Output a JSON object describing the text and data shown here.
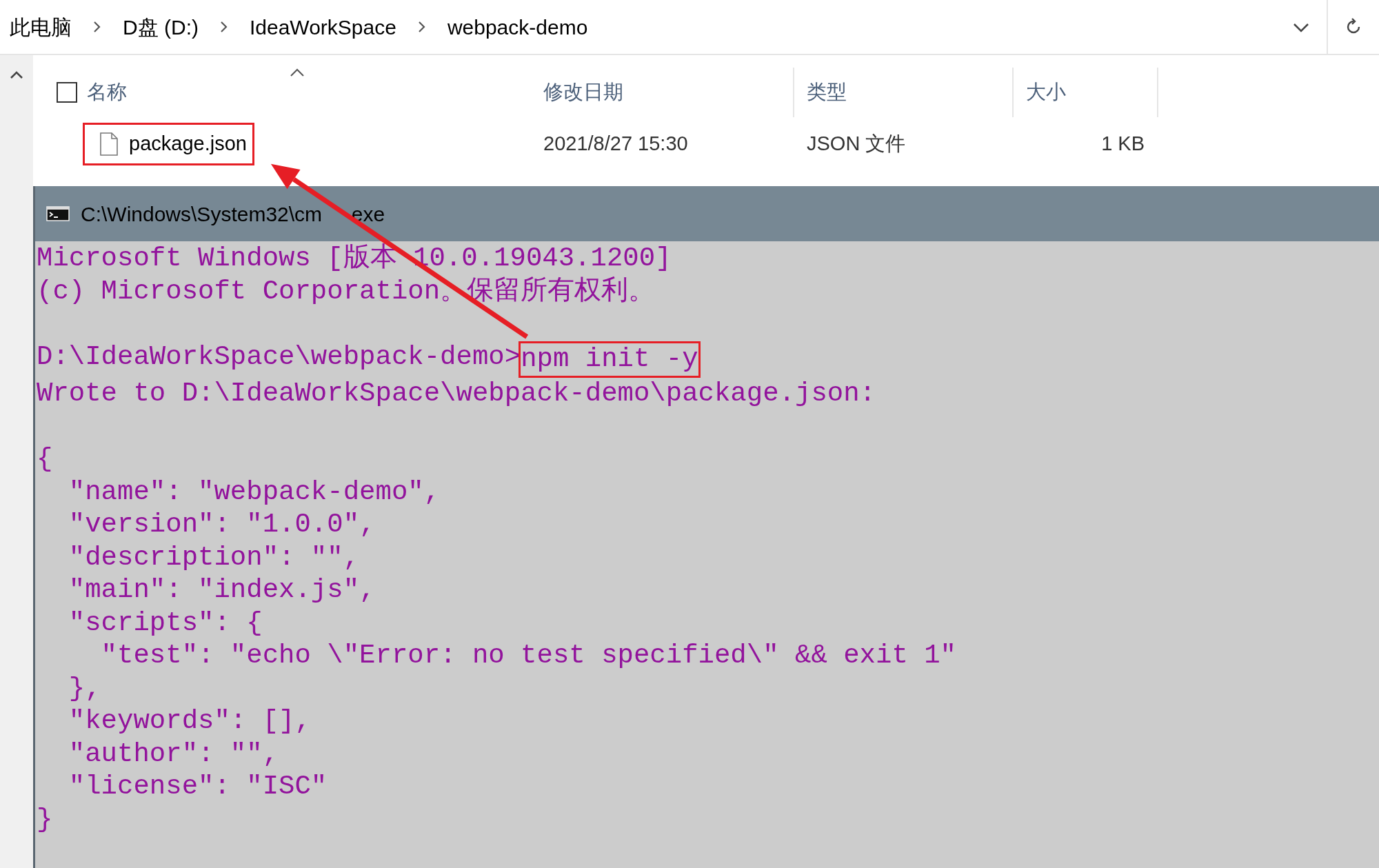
{
  "breadcrumb": [
    {
      "label": "此电脑"
    },
    {
      "label": "D盘 (D:)"
    },
    {
      "label": "IdeaWorkSpace"
    },
    {
      "label": "webpack-demo"
    }
  ],
  "file_list": {
    "select_all": {
      "checked": false
    },
    "columns": [
      {
        "label": "名称",
        "sorted": true
      },
      {
        "label": "修改日期",
        "sorted": false
      },
      {
        "label": "类型",
        "sorted": false
      },
      {
        "label": "大小",
        "sorted": false
      }
    ],
    "rows": [
      {
        "name": "package.json",
        "modified": "2021/8/27 15:30",
        "type": "JSON 文件",
        "size": "1 KB",
        "highlighted": true
      }
    ]
  },
  "console": {
    "title_parts": [
      "C:\\Windows\\System32\\cm",
      "exe"
    ],
    "blocks": [
      [
        {
          "text": "Microsoft Windows [版本 10.0.19043.1200]"
        },
        {
          "text": "(c) Microsoft Corporation。保留所有权利。"
        }
      ],
      [
        {
          "prompt": "D:\\IdeaWorkSpace\\webpack-demo>",
          "command": "npm init -y",
          "highlighted": true
        },
        {
          "text": "Wrote to D:\\IdeaWorkSpace\\webpack-demo\\package.json:"
        }
      ],
      [
        {
          "text": "{"
        },
        {
          "text": "  \"name\": \"webpack-demo\","
        },
        {
          "text": "  \"version\": \"1.0.0\","
        },
        {
          "text": "  \"description\": \"\","
        },
        {
          "text": "  \"main\": \"index.js\","
        },
        {
          "text": "  \"scripts\": {"
        },
        {
          "text": "    \"test\": \"echo \\\"Error: no test specified\\\" && exit 1\""
        },
        {
          "text": "  },"
        },
        {
          "text": "  \"keywords\": [],"
        },
        {
          "text": "  \"author\": \"\","
        },
        {
          "text": "  \"license\": \"ISC\""
        },
        {
          "text": "}"
        }
      ]
    ]
  },
  "annotation": {
    "arrow": true
  }
}
